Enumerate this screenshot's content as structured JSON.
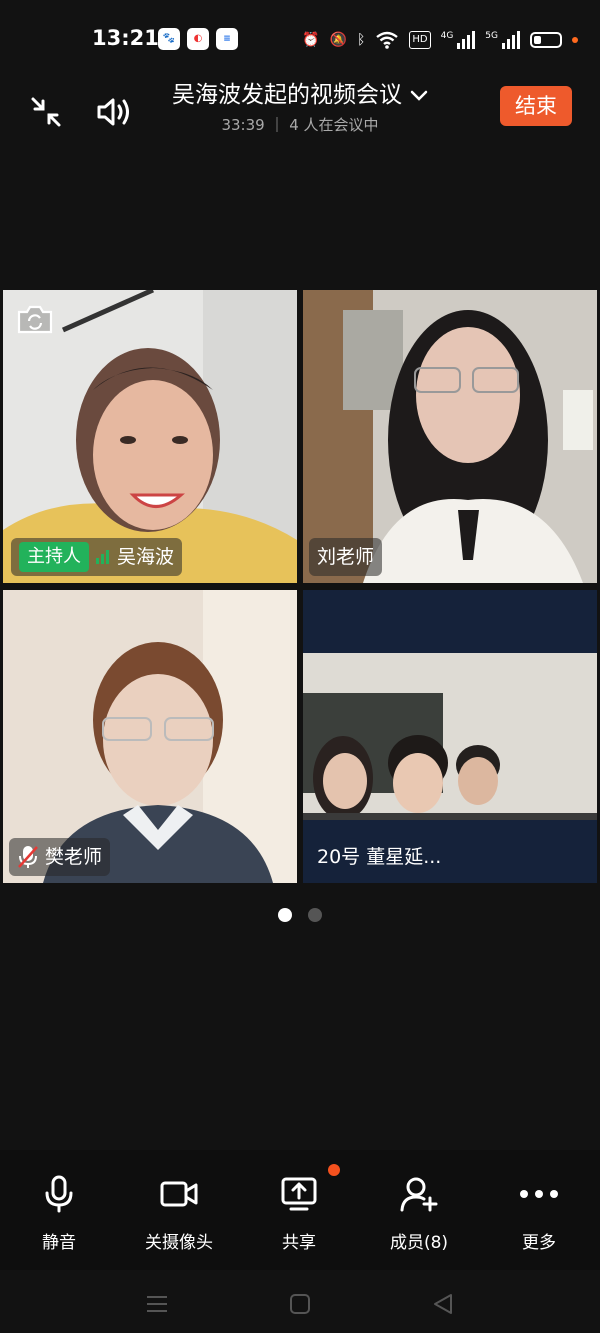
{
  "status_bar": {
    "time": "13:21",
    "app_badges": [
      "baidu-app-icon",
      "netdisk-app-icon",
      "news-app-icon"
    ],
    "icons": [
      "alarm-icon",
      "mute-icon",
      "bluetooth-icon",
      "wifi-icon",
      "hd-icon",
      "signal-4g-icon",
      "signal-5g-icon",
      "battery-icon"
    ],
    "hd_label": "HD",
    "sig1_label": "4G",
    "sig2_label": "5G",
    "battery_level_percent": 40
  },
  "header": {
    "title": "吴海波发起的视频会议",
    "subtitle": "33:39 ｜ 4 人在会议中",
    "end_label": "结束",
    "icons": [
      "minimize-icon",
      "speaker-icon",
      "chevron-down-icon"
    ]
  },
  "participants": [
    {
      "host_tag": "主持人",
      "name": "吴海波",
      "icons": [
        "camera-switch-icon",
        "audio-level-icon"
      ]
    },
    {
      "name": "刘老师"
    },
    {
      "name": "樊老师",
      "icons": [
        "mic-muted-icon"
      ]
    },
    {
      "name": "20号 董星延..."
    }
  ],
  "pager": {
    "pages": 2,
    "current": 1
  },
  "toolbar": {
    "mute_label": "静音",
    "camera_label": "关摄像头",
    "share_label": "共享",
    "members_label": "成员(8)",
    "more_label": "更多"
  },
  "colors": {
    "accent_end": "#ee5a2c",
    "host_green": "#22b25b",
    "notify_dot": "#f4511e"
  }
}
